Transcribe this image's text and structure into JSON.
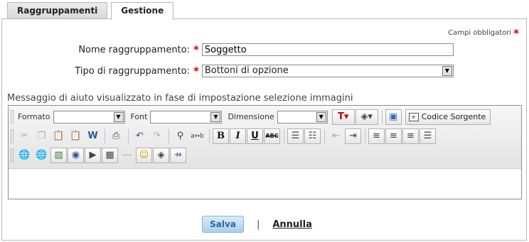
{
  "tabs": [
    {
      "label": "Raggruppamenti",
      "active": false
    },
    {
      "label": "Gestione",
      "active": true
    }
  ],
  "required_note": "Campi obbligatori",
  "form": {
    "name_label": "Nome raggruppamento:",
    "name_value": "Soggetto",
    "type_label": "Tipo di raggruppamento:",
    "type_value": "Bottoni di opzione"
  },
  "help_label": "Messaggio di aiuto visualizzato in fase di impostazione selezione immagini",
  "editor": {
    "format_label": "Formato",
    "font_label": "Font",
    "size_label": "Dimensione",
    "source_label": "Codice Sorgente"
  },
  "footer": {
    "save_label": "Salva",
    "divider": "|",
    "cancel_label": "Annulla"
  },
  "colors": {
    "required_star": "#d40000",
    "save_button_bg": "#a9cfec",
    "save_button_text": "#2a6a9a"
  }
}
